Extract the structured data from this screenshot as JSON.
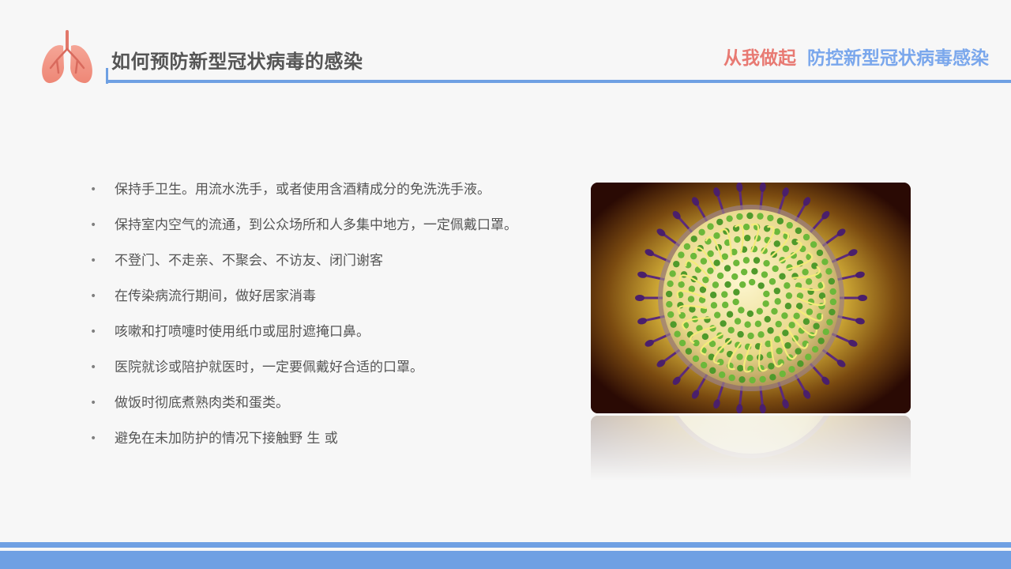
{
  "header": {
    "title": "如何预防新型冠状病毒的感染",
    "slogan_part1": "从我做起",
    "slogan_part2": "防控新型冠状病毒感染",
    "icon": "lung-icon"
  },
  "bullets": {
    "marker": "•",
    "items": [
      "保持手卫生。用流水洗手，或者使用含酒精成分的免洗洗手液。",
      "保持室内空气的流通，到公众场所和人多集中地方，一定佩戴口罩。",
      "不登门、不走亲、不聚会、不访友、闭门谢客",
      "在传染病流行期间，做好居家消毒",
      "咳嗽和打喷嚏时使用纸巾或屈肘遮掩口鼻。",
      "医院就诊或陪护就医时，一定要佩戴好合适的口罩。",
      "做饭时彻底煮熟肉类和蛋类。",
      "避免在未加防护的情况下接触野 生 或"
    ]
  },
  "image": {
    "subject": "coronavirus-illustration"
  },
  "colors": {
    "accent_blue": "#6fa0e3",
    "slogan_red": "#e87a73",
    "slogan_blue": "#7aa7ec",
    "title_gray": "#555555",
    "lung_pink": "#f29a8c"
  }
}
